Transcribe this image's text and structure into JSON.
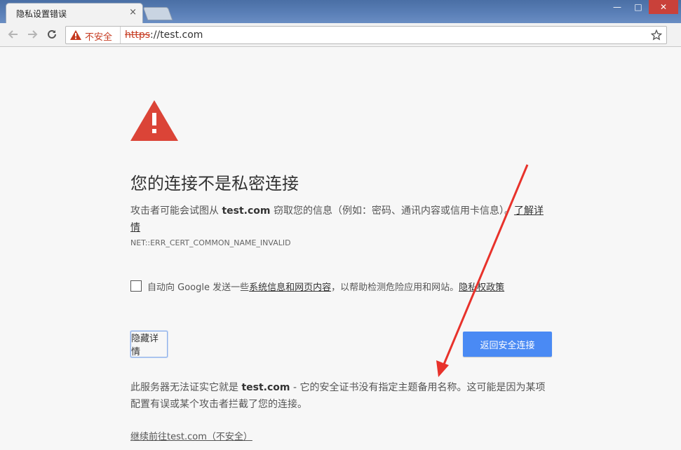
{
  "tab": {
    "title": "隐私设置错误",
    "close": "×"
  },
  "window": {
    "minimize": "—",
    "maximize": "□",
    "close": "✕"
  },
  "omnibox": {
    "security_label": "不安全",
    "scheme": "https",
    "rest": "://test.com"
  },
  "page": {
    "title": "您的连接不是私密连接",
    "intro_pre": "攻击者可能会试图从 ",
    "intro_host": "test.com",
    "intro_post": " 窃取您的信息（例如：密码、通讯内容或信用卡信息）。",
    "learn_more": "了解详情",
    "error_code": "NET::ERR_CERT_COMMON_NAME_INVALID",
    "checkbox_pre": "自动向 Google 发送一些",
    "checkbox_link": "系统信息和网页内容",
    "checkbox_mid": "，以帮助检测危险应用和网站。",
    "privacy_link": "隐私权政策",
    "hide_details": "隐藏详情",
    "back_to_safety": "返回安全连接",
    "details_pre": "此服务器无法证实它就是 ",
    "details_host": "test.com",
    "details_post": " - 它的安全证书没有指定主题备用名称。这可能是因为某项配置有误或某个攻击者拦截了您的连接。",
    "proceed_link": "继续前往test.com（不安全）"
  },
  "colors": {
    "danger": "#db4437",
    "primary": "#4a8af4",
    "insecure": "#c5391f",
    "annotation": "#e8322b"
  }
}
